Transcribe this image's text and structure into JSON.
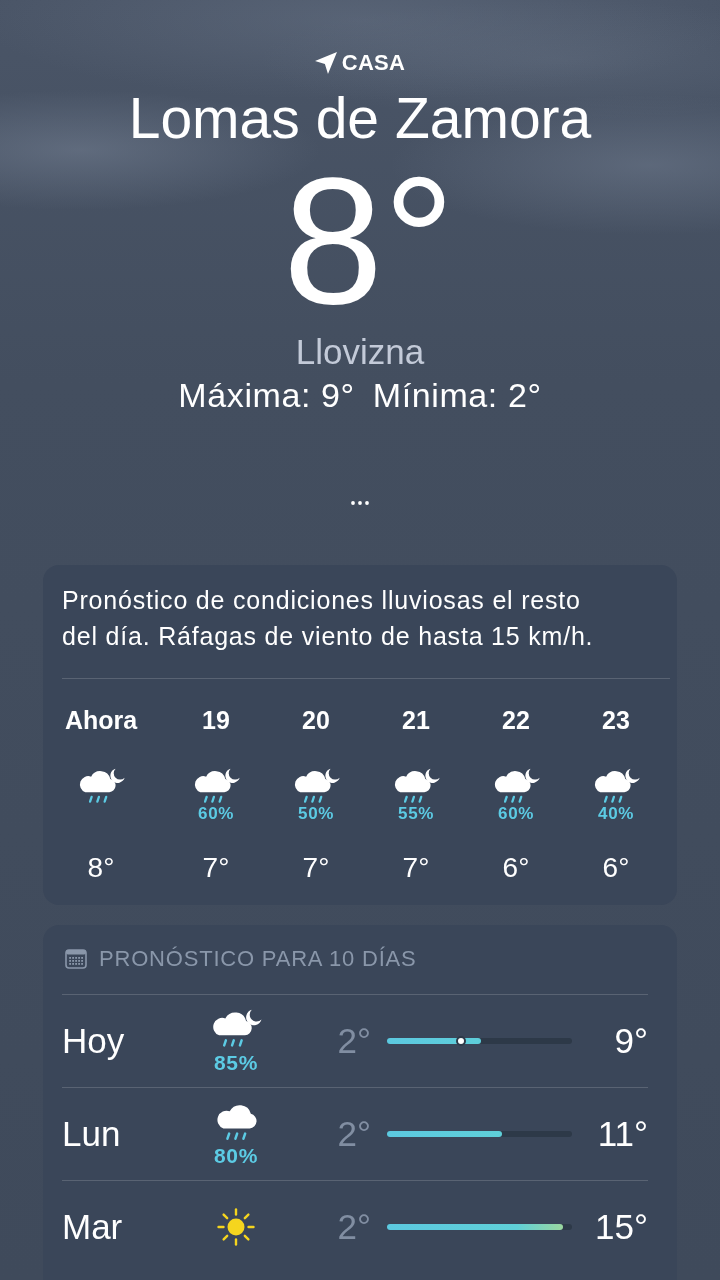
{
  "location": {
    "label": "CASA"
  },
  "city": "Lomas de Zamora",
  "temperature": "8°",
  "condition": "Llovizna",
  "high": "Máxima: 9°",
  "low": "Mínima: 2°",
  "summary": "Pronóstico de condiciones lluviosas el resto del día. Ráfagas de viento de hasta 15 km/h.",
  "hourly": [
    {
      "time": "Ahora",
      "kind": "nightrain",
      "temp": "8°"
    },
    {
      "time": "19",
      "kind": "nightrain",
      "precip": "60%",
      "temp": "7°"
    },
    {
      "time": "20",
      "kind": "nightrain",
      "precip": "50%",
      "temp": "7°"
    },
    {
      "time": "21",
      "kind": "nightrain",
      "precip": "55%",
      "temp": "7°"
    },
    {
      "time": "22",
      "kind": "nightrain",
      "precip": "60%",
      "temp": "6°"
    },
    {
      "time": "23",
      "kind": "nightrain",
      "precip": "40%",
      "temp": "6°"
    }
  ],
  "daily": {
    "title": "PRONÓSTICO PARA 10 DÍAS",
    "days": [
      {
        "day": "Hoy",
        "kind": "nightrain",
        "precip": "85%",
        "low": "2°",
        "high": "9°",
        "bar": {
          "level": 0.51
        },
        "current": {
          "level": 0.4
        }
      },
      {
        "day": "Lun",
        "kind": "rain",
        "precip": "80%",
        "low": "2°",
        "high": "11°",
        "bar": {
          "level": 0.62
        }
      },
      {
        "day": "Mar",
        "kind": "sunny",
        "low": "2°",
        "high": "15°",
        "bar": {
          "level": 0.95
        }
      }
    ]
  }
}
